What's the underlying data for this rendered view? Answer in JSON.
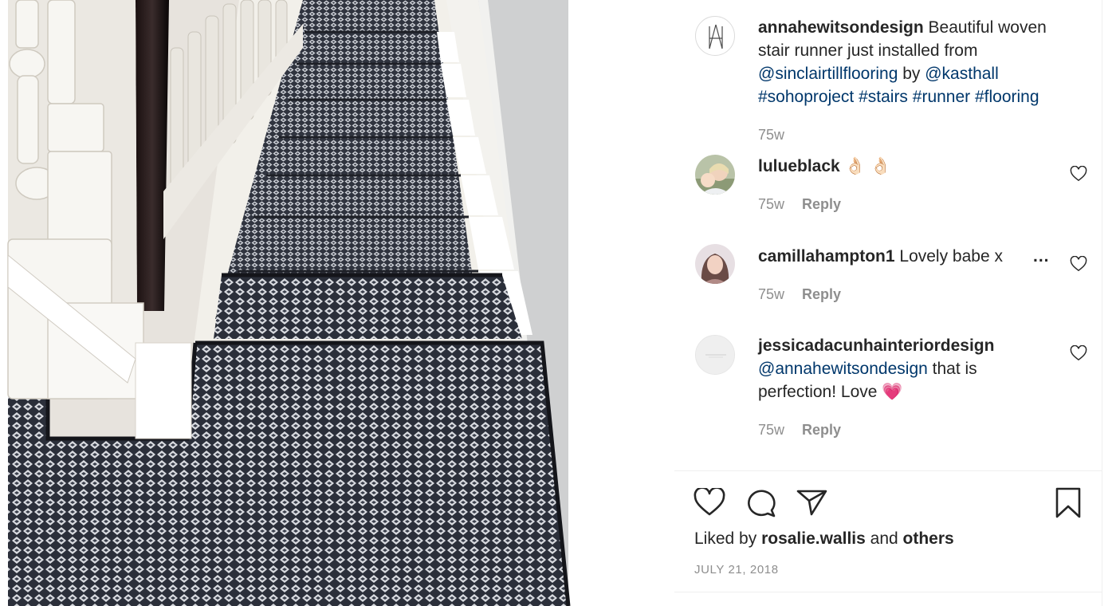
{
  "post": {
    "author": "annahewitsondesign",
    "caption_text_1": " Beautiful woven stair runner just installed from ",
    "mention_1": "@sinclairtillflooring",
    "caption_text_2": " by ",
    "mention_2": "@kasthall",
    "hashtags": "#sohoproject #stairs #runner #flooring",
    "age": "75w",
    "avatar_monogram": "A"
  },
  "comments": [
    {
      "user": "lulueblack",
      "text": " 👌🏻 👌🏻",
      "age": "75w",
      "reply_label": "Reply"
    },
    {
      "user": "camillahampton1",
      "text": " Lovely babe x",
      "more": "...",
      "age": "75w",
      "reply_label": "Reply"
    },
    {
      "user": "jessicadacunhainteriordesign",
      "mention": "@annahewitsondesign",
      "text": " that is perfection! Love 💗",
      "age": "75w",
      "reply_label": "Reply"
    }
  ],
  "actions": {
    "like_icon": "heart-icon",
    "comment_icon": "comment-icon",
    "share_icon": "share-icon",
    "save_icon": "bookmark-icon"
  },
  "likes": {
    "prefix": "Liked by ",
    "user": "rosalie.wallis",
    "middle": " and ",
    "others": "others"
  },
  "date": "July 21, 2018",
  "colors": {
    "link": "#00376b",
    "meta": "#8e8e8e",
    "text": "#262626",
    "divider": "#efefef"
  }
}
